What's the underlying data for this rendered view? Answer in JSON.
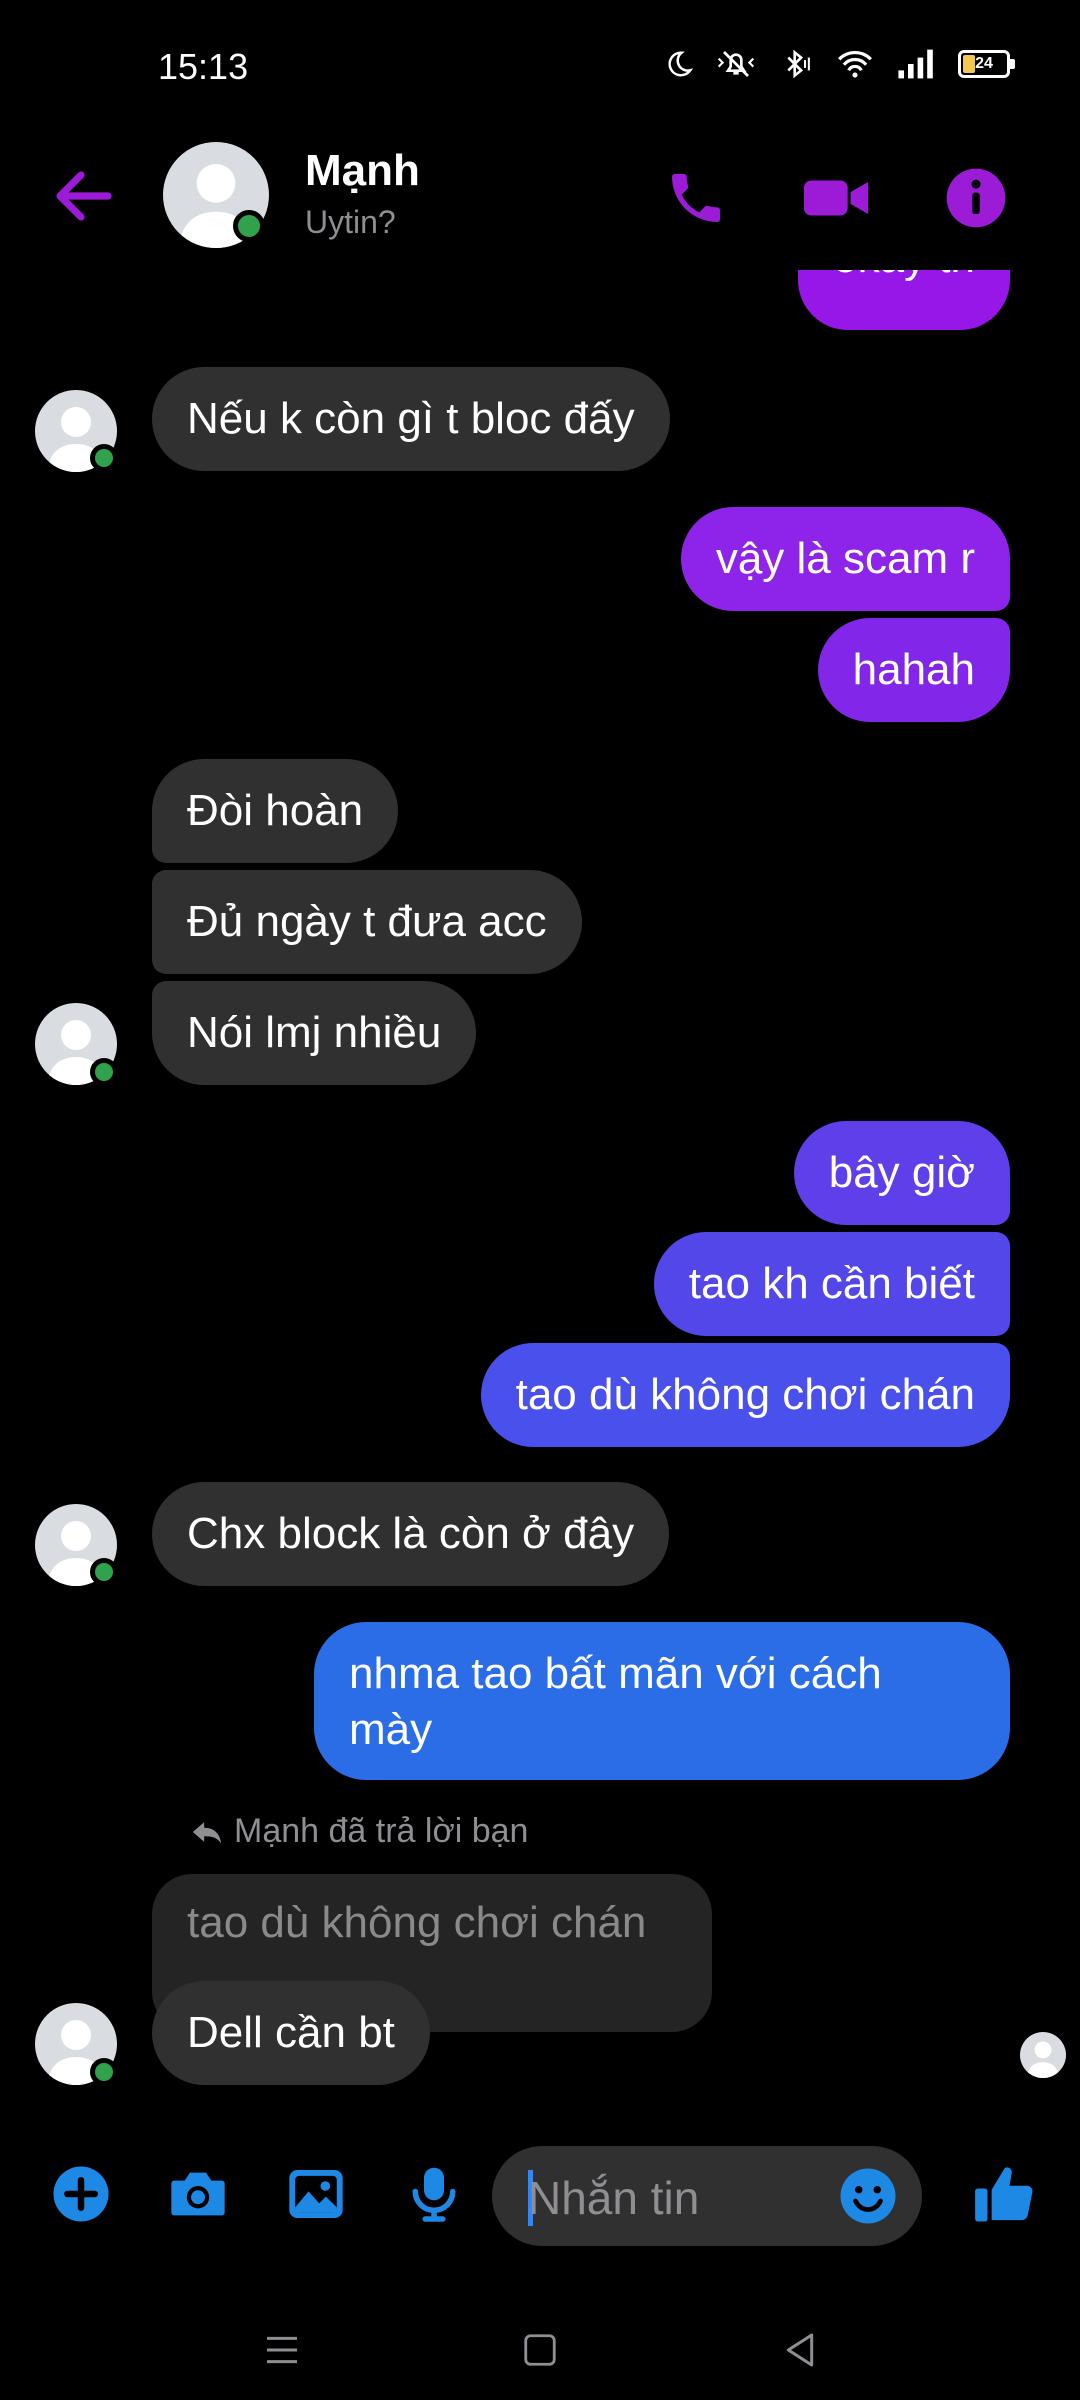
{
  "status_bar": {
    "time": "15:13",
    "battery": "24"
  },
  "header": {
    "name": "Mạnh",
    "subtitle": "Uytin?"
  },
  "messages": {
    "m0": "okay tn",
    "m1": "Nếu k còn gì t bloc đấy",
    "m2": "vậy là scam r",
    "m3": "hahah",
    "m4": "Đòi hoàn",
    "m5": "Đủ ngày t đưa acc",
    "m6": "Nói lmj nhiều",
    "m7": "bây giờ",
    "m8": "tao kh cần biết",
    "m9": "tao dù không chơi chán",
    "m10": "Chx block là còn ở đây",
    "m11_line1": "nhma tao bất mãn với cách",
    "m11_line2": "mày",
    "reply_note": "Mạnh đã trả lời bạn",
    "quoted": "tao dù không chơi chán",
    "m12": "Dell cần bt"
  },
  "composer": {
    "placeholder": "Nhắn tin"
  },
  "colors": {
    "accent": "#9b1bd6",
    "out_purple": "#8e24e9",
    "out_indigo": "#5944ea",
    "out_blue": "#2a6de6",
    "incoming": "#303030",
    "composer_blue": "#1e88e5"
  },
  "icons": {
    "back": "arrow-left-icon",
    "call": "phone-icon",
    "video": "video-camera-icon",
    "info": "info-icon",
    "add": "plus-circle-icon",
    "camera": "camera-icon",
    "gallery": "image-icon",
    "mic": "microphone-icon",
    "emoji": "smiley-icon",
    "like": "thumbs-up-icon"
  }
}
